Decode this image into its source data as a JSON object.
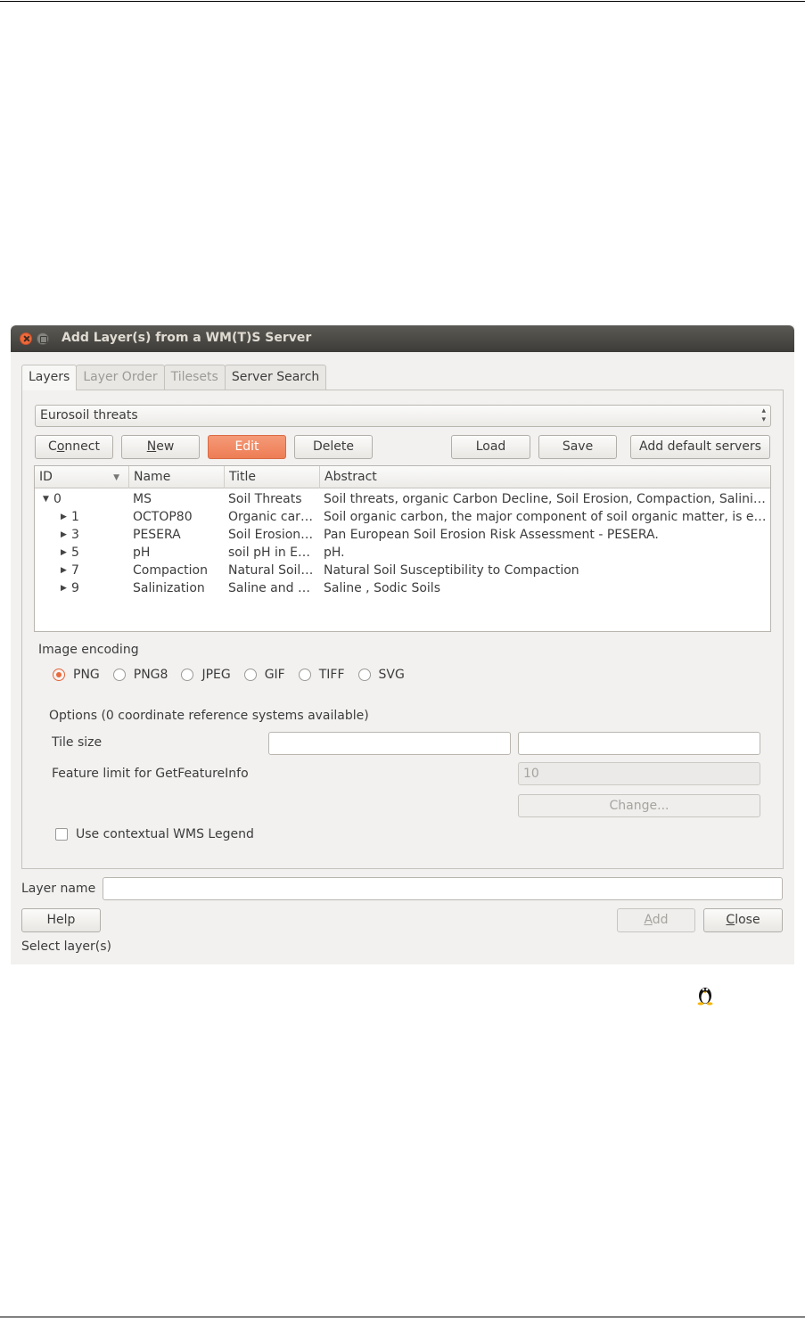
{
  "window": {
    "title": "Add Layer(s) from a WM(T)S Server"
  },
  "tabs": [
    {
      "label": "Layers",
      "state": "active"
    },
    {
      "label": "Layer Order",
      "state": "disabled"
    },
    {
      "label": "Tilesets",
      "state": "disabled"
    },
    {
      "label": "Server Search",
      "state": "enabled"
    }
  ],
  "server_select": {
    "value": "Eurosoil threats"
  },
  "buttons": {
    "connect_pre": "C",
    "connect_u": "o",
    "connect_post": "nnect",
    "new_pre": "",
    "new_u": "N",
    "new_post": "ew",
    "edit": "Edit",
    "delete": "Delete",
    "load": "Load",
    "save": "Save",
    "add_default": "Add default servers",
    "help": "Help",
    "add_pre": "",
    "add_u": "A",
    "add_post": "dd",
    "close_pre": "",
    "close_u": "C",
    "close_post": "lose",
    "change": "Change..."
  },
  "table": {
    "headers": {
      "id": "ID",
      "name": "Name",
      "title": "Title",
      "abstract": "Abstract"
    },
    "rows": [
      {
        "id": "0",
        "name": "MS",
        "title": "Soil Threats",
        "abstract": "Soil threats, organic Carbon Decline, Soil Erosion, Compaction, Salini…",
        "expanded": true,
        "level": 0
      },
      {
        "id": "1",
        "name": "OCTOP80",
        "title": "Organic car…",
        "abstract": "Soil organic carbon, the major component of soil organic matter, is e…",
        "expanded": false,
        "level": 1
      },
      {
        "id": "3",
        "name": "PESERA",
        "title": "Soil Erosion…",
        "abstract": "Pan European Soil Erosion Risk Assessment - PESERA.",
        "expanded": false,
        "level": 1
      },
      {
        "id": "5",
        "name": "pH",
        "title": "soil pH in E…",
        "abstract": "pH.",
        "expanded": false,
        "level": 1
      },
      {
        "id": "7",
        "name": "Compaction",
        "title": "Natural Soil…",
        "abstract": "Natural Soil Susceptibility to Compaction",
        "expanded": false,
        "level": 1
      },
      {
        "id": "9",
        "name": "Salinization",
        "title": "Saline and S…",
        "abstract": "Saline , Sodic Soils",
        "expanded": false,
        "level": 1
      }
    ]
  },
  "image_encoding": {
    "label": "Image encoding",
    "options": [
      "PNG",
      "PNG8",
      "JPEG",
      "GIF",
      "TIFF",
      "SVG"
    ],
    "selected": "PNG"
  },
  "options": {
    "heading": "Options (0 coordinate reference systems available)",
    "tile_size_label": "Tile size",
    "tile_width": "",
    "tile_height": "",
    "feature_limit_label": "Feature limit for GetFeatureInfo",
    "feature_limit": "10",
    "contextual_legend_label": "Use contextual WMS Legend",
    "contextual_legend_checked": false
  },
  "layer_name": {
    "label": "Layer name",
    "value": ""
  },
  "status": "Select layer(s)",
  "colors": {
    "accent": "#ed7d55",
    "titlebar": "#4a4945"
  }
}
